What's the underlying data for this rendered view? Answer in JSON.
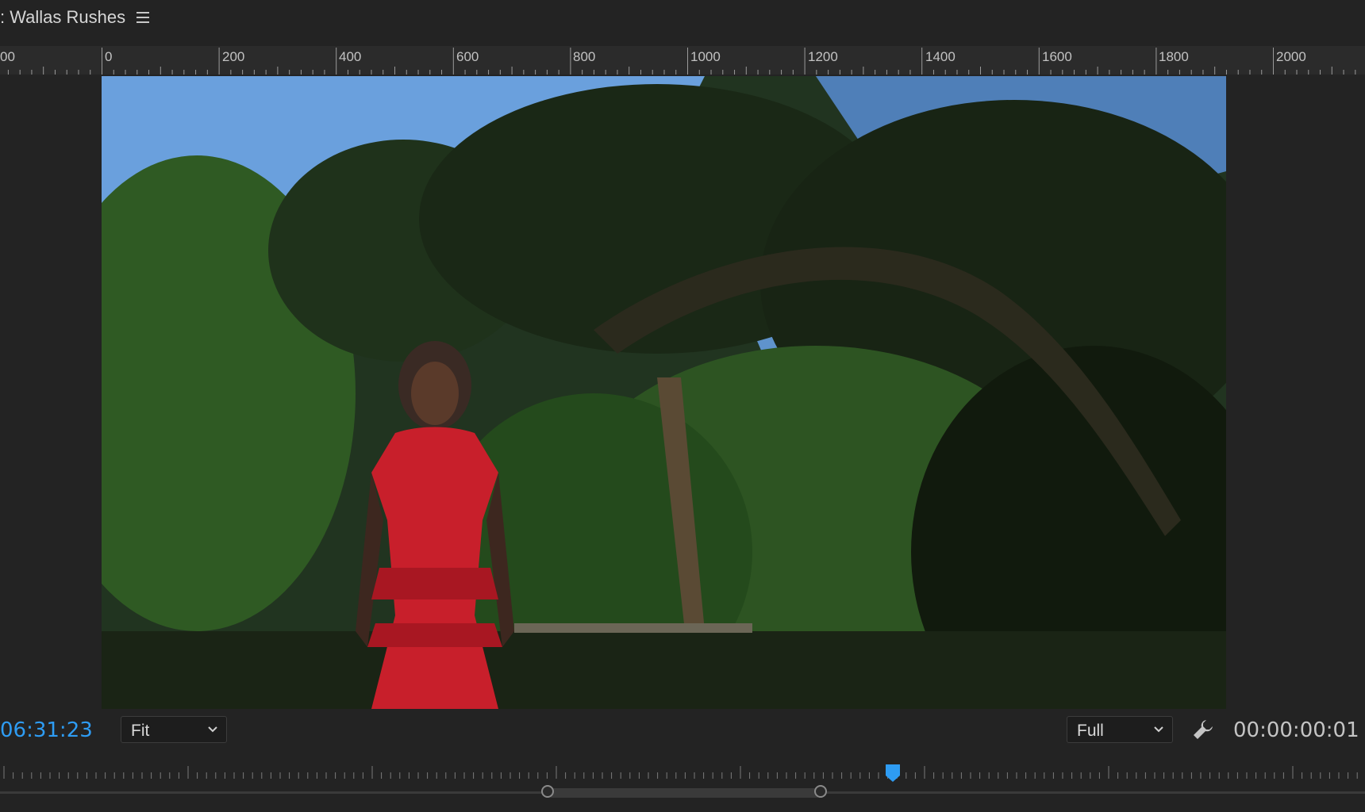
{
  "panel": {
    "title": ": Wallas Rushes"
  },
  "ruler": {
    "labels": [
      "00",
      "0",
      "200",
      "400",
      "600",
      "800",
      "1000",
      "1200",
      "1400",
      "1600",
      "1800",
      "2000"
    ]
  },
  "controls": {
    "current_timecode": "06:31:23",
    "zoom_select": "Fit",
    "resolution_select": "Full",
    "duration_timecode": "00:00:00:01"
  },
  "colors": {
    "accent": "#2e9cf3",
    "background": "#232323"
  },
  "icons": {
    "menu": "hamburger-menu-icon",
    "dropdown": "chevron-down-icon",
    "settings": "wrench-icon",
    "playhead": "playhead-marker-icon"
  }
}
